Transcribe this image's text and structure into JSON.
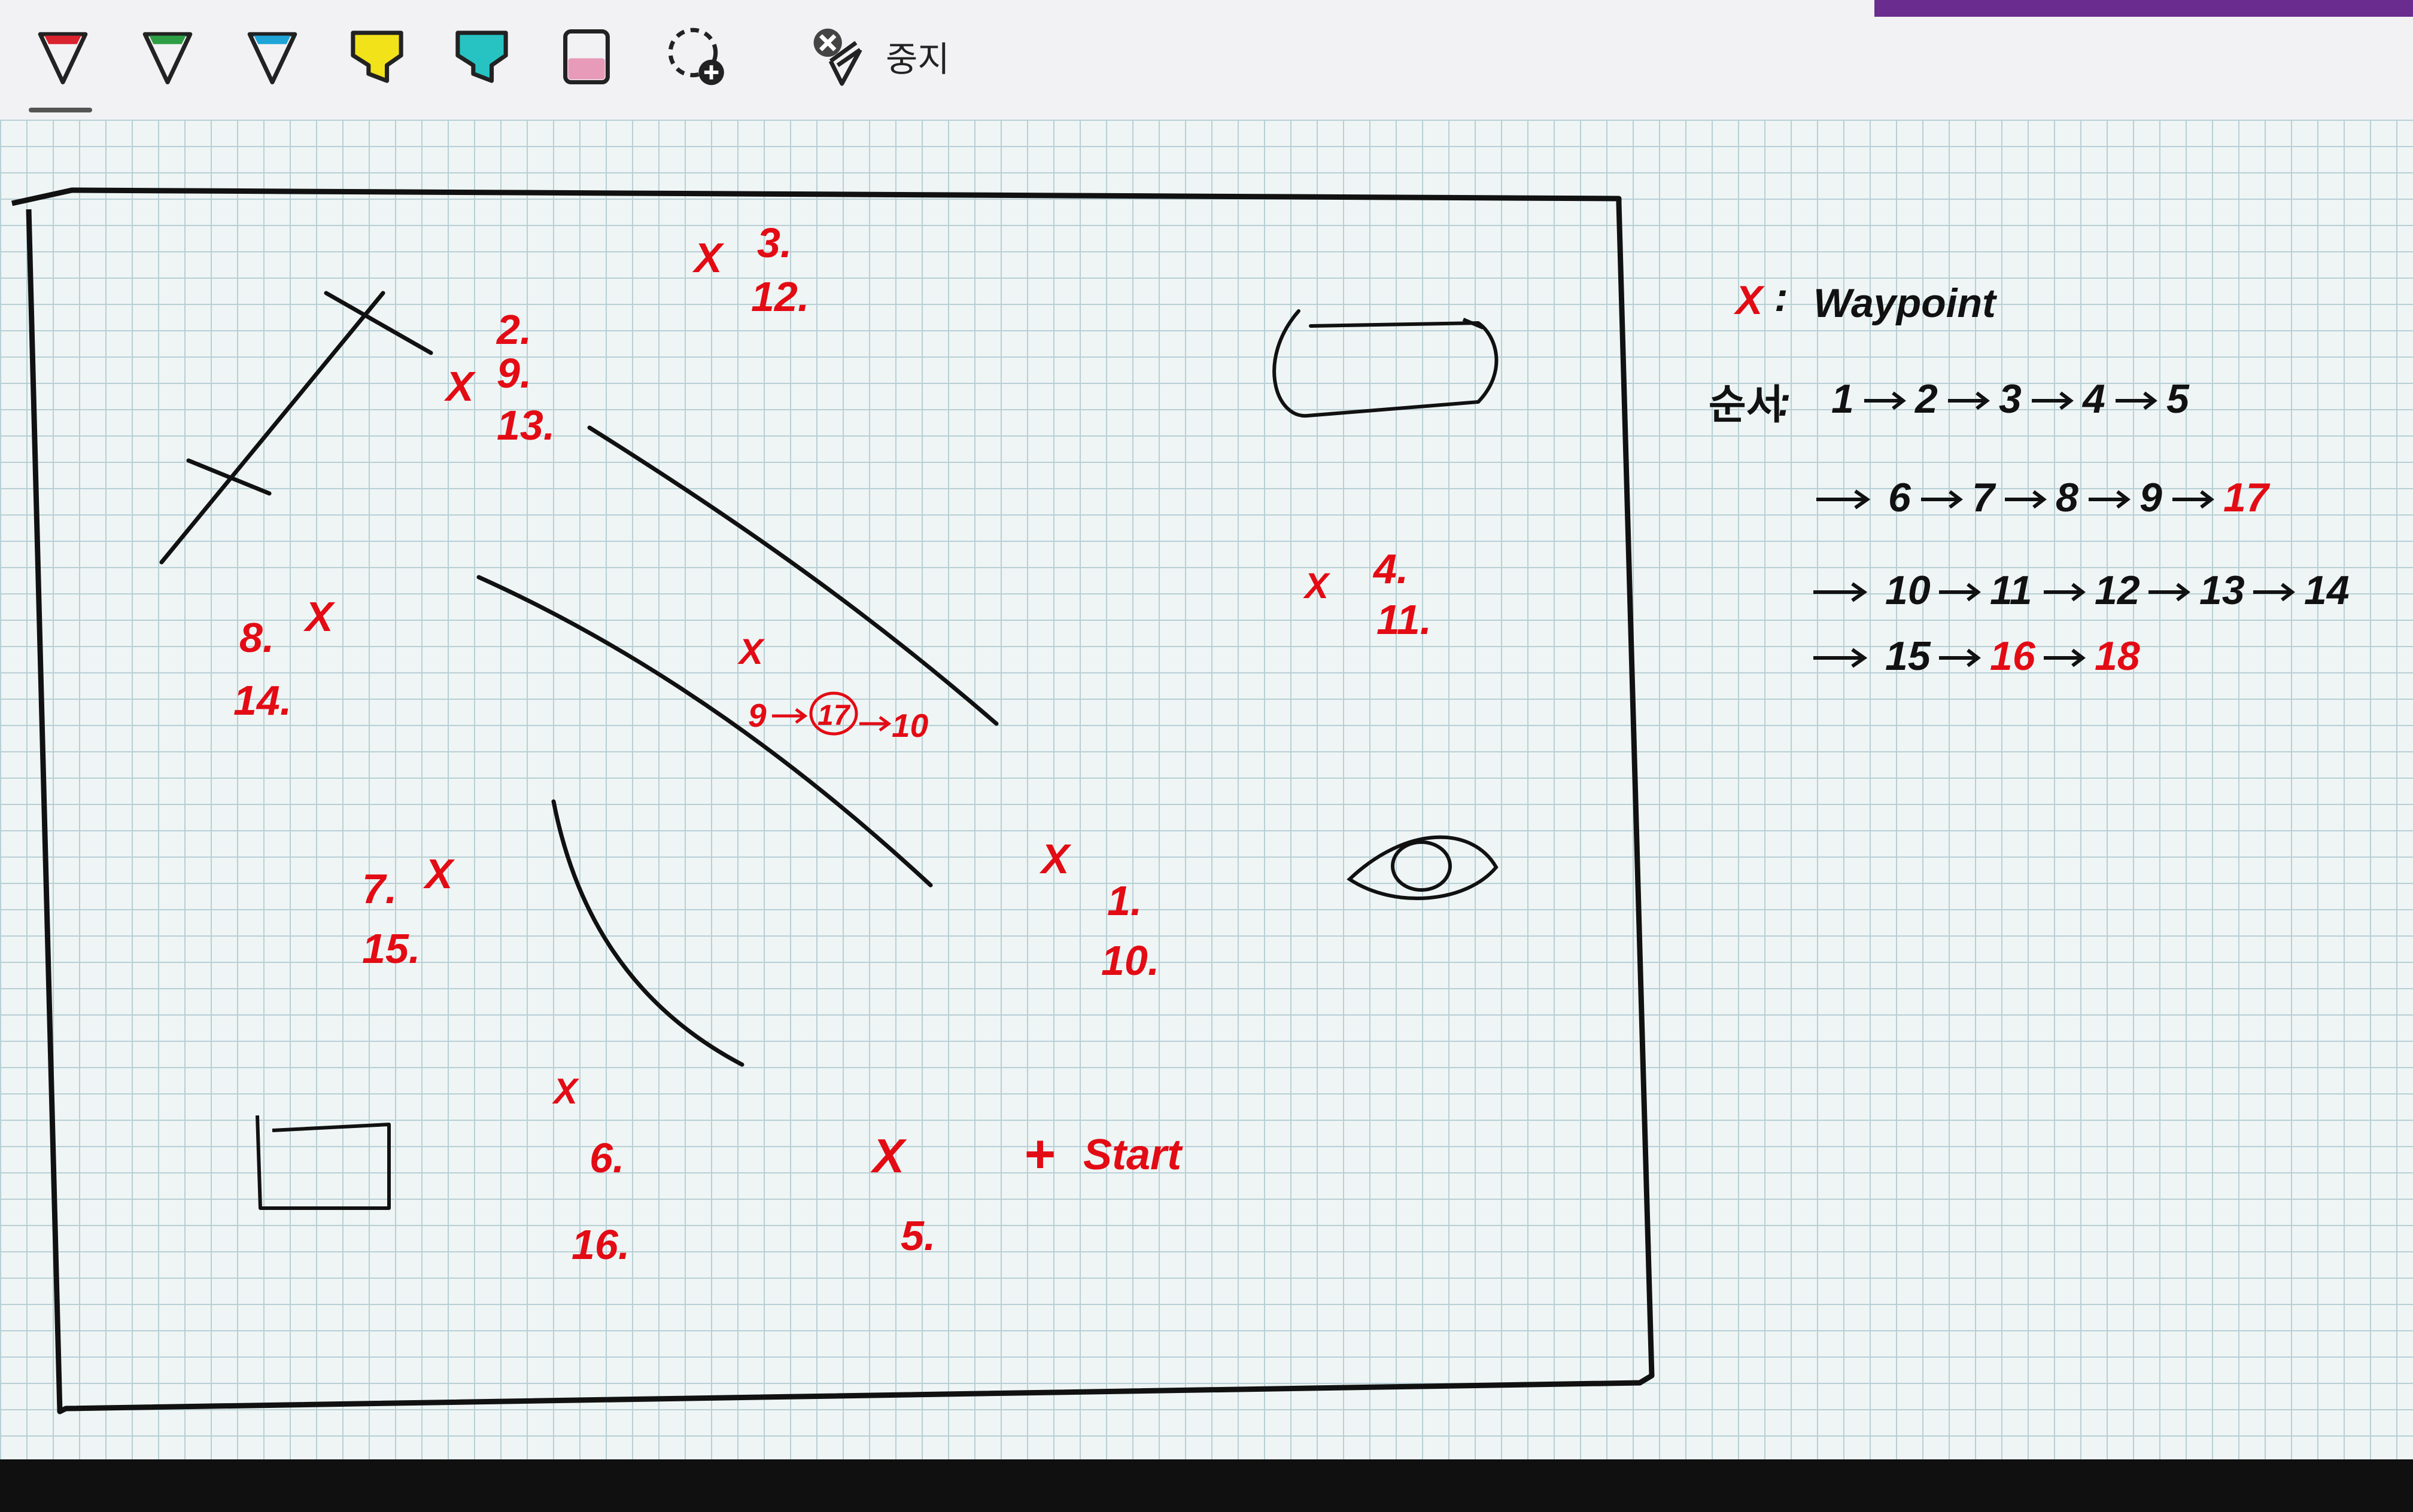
{
  "toolbar": {
    "tools": [
      {
        "name": "pen-red",
        "color": "#d9232e"
      },
      {
        "name": "pen-green",
        "color": "#2e9e44"
      },
      {
        "name": "pen-cyan",
        "color": "#1fa4d8"
      },
      {
        "name": "highlighter-yellow",
        "color": "#f2e21a"
      },
      {
        "name": "highlighter-teal",
        "color": "#27c3c3"
      },
      {
        "name": "highlighter-pink",
        "color": "#e79bb8"
      }
    ],
    "lasso_icon": "lasso-add-icon",
    "stop_icon": "pen-cancel-icon",
    "stop_label": "중지"
  },
  "canvas": {
    "ink_color": "#111111",
    "annotation_color": "#e30b14",
    "waypoints": [
      {
        "mark": "X",
        "labels": [
          "3.",
          "12."
        ]
      },
      {
        "mark": "X",
        "labels": [
          "2.",
          "9.",
          "13."
        ]
      },
      {
        "mark": "X",
        "labels": [
          "4.",
          "11."
        ]
      },
      {
        "mark": "X",
        "labels": [
          "8.",
          "14."
        ]
      },
      {
        "mark": "X",
        "labels": [
          "9",
          "17",
          "10"
        ]
      },
      {
        "mark": "X",
        "labels": [
          "1.",
          "10."
        ]
      },
      {
        "mark": "X",
        "labels": [
          "7.",
          "15."
        ]
      },
      {
        "mark": "X",
        "labels": [
          "6.",
          "16."
        ]
      },
      {
        "mark": "X",
        "labels": [
          "5."
        ]
      }
    ],
    "start": {
      "mark": "+",
      "label": "Start"
    },
    "legend": {
      "mark": "X",
      "colon": ":",
      "text": "Waypoint",
      "order_label": "순서",
      "order_colon": ":",
      "order_lines": [
        [
          "1",
          "2",
          "3",
          "4",
          "5"
        ],
        [
          "6",
          "7",
          "8",
          "9",
          "17"
        ],
        [
          "10",
          "11",
          "12",
          "13",
          "14"
        ],
        [
          "15",
          "16",
          "18"
        ]
      ]
    }
  }
}
